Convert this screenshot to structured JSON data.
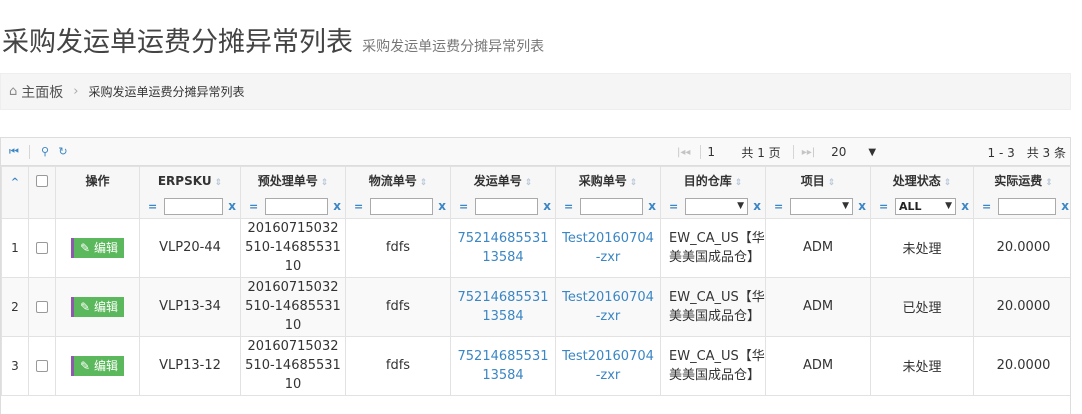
{
  "page": {
    "title": "采购发运单运费分摊异常列表",
    "subtitle": "采购发运单运费分摊异常列表"
  },
  "breadcrumb": {
    "home_icon": "home-icon",
    "home": "主面板",
    "current": "采购发运单运费分摊异常列表"
  },
  "pager": {
    "current_page": "1",
    "total_pages": "共 1 页",
    "page_size": "20",
    "record_info": "1 - 3　共 3 条"
  },
  "columns": {
    "actions": "操作",
    "erpsku": "ERPSKU",
    "pre_no": "预处理单号",
    "logistics_no": "物流单号",
    "ship_no": "发运单号",
    "po_no": "采购单号",
    "warehouse": "目的仓库",
    "project": "项目",
    "status": "处理状态",
    "freight": "实际运费"
  },
  "filters": {
    "eq": "=",
    "clear": "x",
    "status_value": "ALL"
  },
  "rows": [
    {
      "num": "1",
      "edit": "编辑",
      "erpsku": "VLP20-44",
      "pre_no": "20160715032510-1468553110",
      "logistics_no": "fdfs",
      "ship_no": "7521468553113584",
      "po_no": "Test20160704-zxr",
      "warehouse": "EW_CA_US【华美美国成品仓】",
      "project": "ADM",
      "status": "未处理",
      "freight": "20.0000"
    },
    {
      "num": "2",
      "edit": "编辑",
      "erpsku": "VLP13-34",
      "pre_no": "20160715032510-1468553110",
      "logistics_no": "fdfs",
      "ship_no": "7521468553113584",
      "po_no": "Test20160704-zxr",
      "warehouse": "EW_CA_US【华美美国成品仓】",
      "project": "ADM",
      "status": "已处理",
      "freight": "20.0000"
    },
    {
      "num": "3",
      "edit": "编辑",
      "erpsku": "VLP13-12",
      "pre_no": "20160715032510-1468553110",
      "logistics_no": "fdfs",
      "ship_no": "7521468553113584",
      "po_no": "Test20160704-zxr",
      "warehouse": "EW_CA_US【华美美国成品仓】",
      "project": "ADM",
      "status": "未处理",
      "freight": "20.0000"
    }
  ],
  "colors": {
    "link": "#3b86c4",
    "edit_button": "#5cb85c",
    "edit_border": "#8b5aab"
  }
}
